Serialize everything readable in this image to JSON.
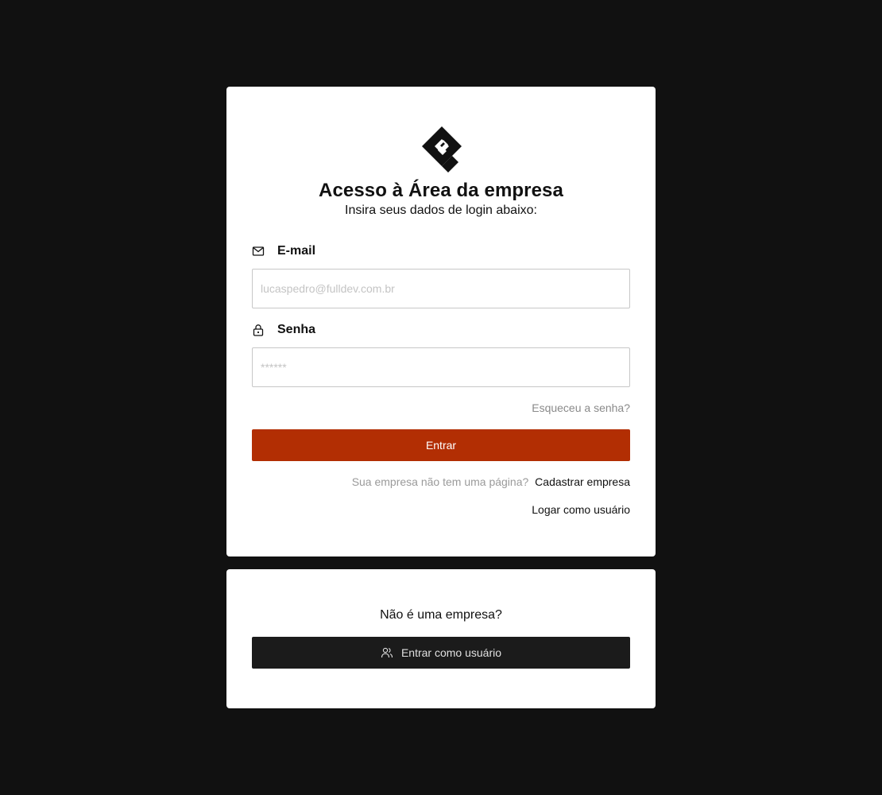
{
  "login_card": {
    "logo": "fulldev-logo",
    "title": "Acesso à Área da empresa",
    "subtitle": "Insira seus dados de login abaixo:",
    "email": {
      "icon": "mail-icon",
      "label": "E-mail",
      "value": "",
      "placeholder": "lucaspedro@fulldev.com.br"
    },
    "password": {
      "icon": "lock-icon",
      "label": "Senha",
      "value": "",
      "placeholder": "******"
    },
    "forgot_label": "Esqueceu a senha?",
    "submit_label": "Entrar",
    "signup_prompt": "Sua empresa não tem uma página?",
    "signup_link": "Cadastrar empresa",
    "user_login_link": "Logar como usuário"
  },
  "user_card": {
    "prompt": "Não é uma empresa?",
    "button_icon": "users-icon",
    "button_label": "Entrar como usuário"
  },
  "colors": {
    "background": "#111111",
    "card": "#ffffff",
    "primary": "#b22e03",
    "dark_button": "#1b1b1b"
  }
}
